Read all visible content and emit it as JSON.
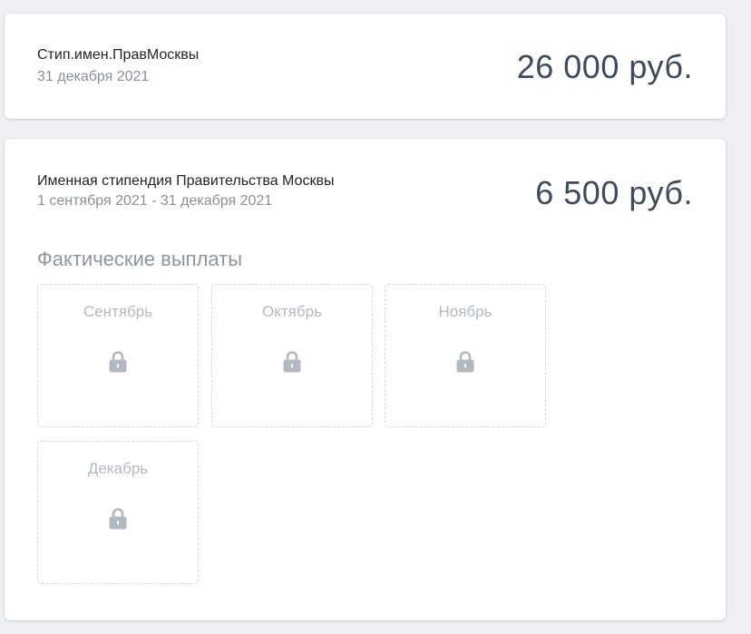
{
  "scholarships": [
    {
      "title": "Стип.имен.ПравМосквы",
      "date": "31 декабря 2021",
      "amount": "26 000 руб."
    },
    {
      "title": "Именная стипендия Правительства Москвы",
      "date": "1 сентября 2021 - 31 декабря 2021",
      "amount": "6 500 руб.",
      "payments_heading": "Фактические выплаты",
      "months": [
        {
          "label": "Сентябрь",
          "icon": "lock-icon"
        },
        {
          "label": "Октябрь",
          "icon": "lock-icon"
        },
        {
          "label": "Ноябрь",
          "icon": "lock-icon"
        },
        {
          "label": "Декабрь",
          "icon": "lock-icon"
        }
      ]
    }
  ],
  "colors": {
    "background": "#eef0f3",
    "card": "#ffffff",
    "amount_text": "#3f4a5a",
    "muted_text": "#8a9099",
    "lock_icon": "#b3b9c1"
  }
}
